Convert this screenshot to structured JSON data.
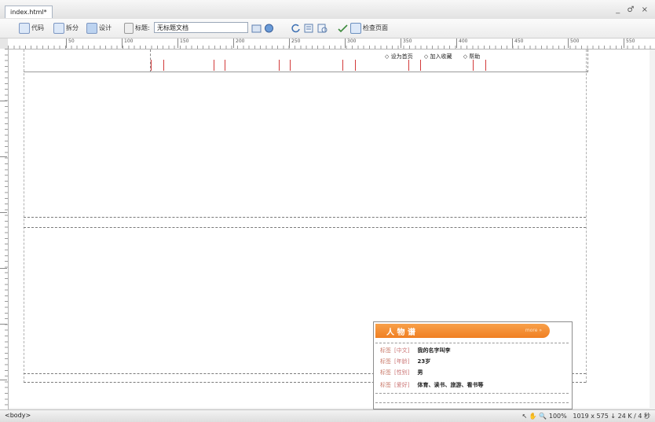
{
  "window": {
    "tab_label": "index.html*",
    "controls": "_ ♂ ×"
  },
  "toolbar": {
    "code_label": "代码",
    "split_label": "拆分",
    "design_label": "设计",
    "title_label": "标题:",
    "title_value": "无标题文档",
    "check_page_label": "检查页面"
  },
  "ruler": {
    "h_labels": [
      "50",
      "100",
      "150",
      "200",
      "250",
      "300",
      "350",
      "400",
      "450",
      "500",
      "550",
      "600",
      "650",
      "700",
      "750",
      "800"
    ]
  },
  "page": {
    "nav_links": [
      "设为首页",
      "加入收藏",
      "帮助"
    ]
  },
  "widget": {
    "title": "人 物 谱",
    "more": "more »",
    "rows": [
      {
        "kind": "标签",
        "tag": "[中文]",
        "value": "我的名字叫李"
      },
      {
        "kind": "标签",
        "tag": "[年龄]",
        "value": "23岁"
      },
      {
        "kind": "标签",
        "tag": "[性别]",
        "value": "男"
      },
      {
        "kind": "标签",
        "tag": "[爱好]",
        "value": "体育、读书、旅游、看书等"
      }
    ]
  },
  "status": {
    "tag_selector": "<body>",
    "zoom": "100%",
    "dims": "1019 x 575 ↓ 24 K / 4 秒"
  }
}
